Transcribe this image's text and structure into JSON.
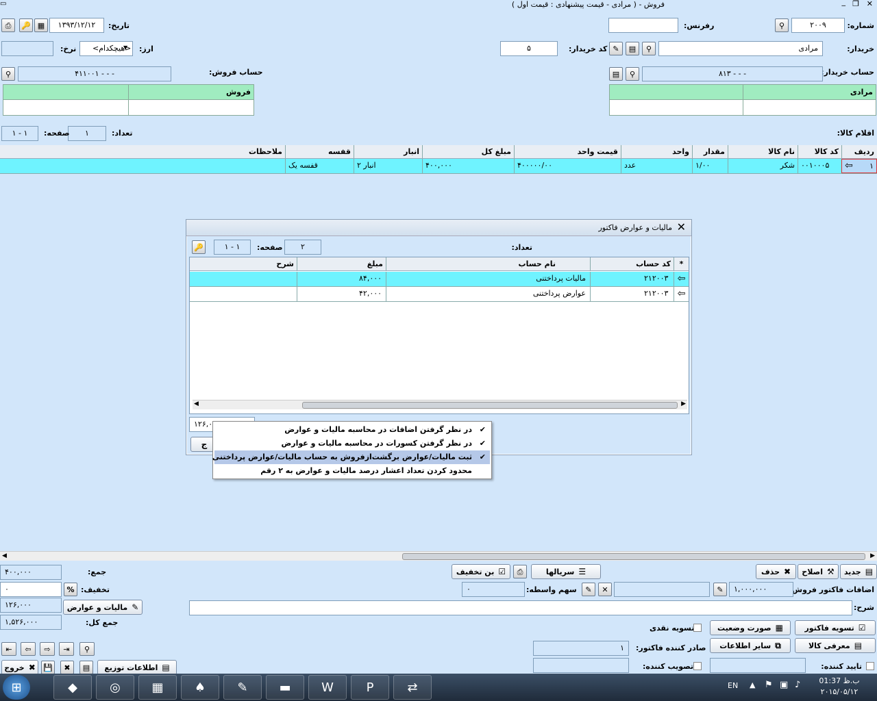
{
  "window": {
    "title": "فروش - ( مرادی - قیمت پیشنهادی : قیمت اول )"
  },
  "header": {
    "number_label": "شماره:",
    "number_value": "۲۰۰۹",
    "ref_label": "رفرنس:",
    "ref_value": "",
    "date_label": "تاریخ:",
    "date_value": "۱۳۹۳/۱۲/۱۲",
    "buyer_label": "خریدار:",
    "buyer_value": "مرادی",
    "buyer_code_label": "کد خریدار:",
    "buyer_code_value": "۵",
    "currency_label": "ارز:",
    "currency_value": "<هیچکدام>",
    "rate_label": "نرخ:",
    "rate_value": ""
  },
  "buyer_account": {
    "label": "حساب خریدار:",
    "value": "۸۱۳ - - -",
    "table_header": "مرادی"
  },
  "sales_account": {
    "label": "حساب فروش:",
    "value": "۴۱۱۰۰۱ - - -",
    "table_header": "فروش"
  },
  "items_bar": {
    "label": "اقلام کالا:",
    "count_label": "تعداد:",
    "count_value": "۱",
    "page_label": "صفحه:",
    "page_value": "۱ - ۱"
  },
  "items_table": {
    "headers": [
      "ردیف",
      "کد کالا",
      "نام کالا",
      "مقدار",
      "واحد",
      "قیمت واحد",
      "مبلغ کل",
      "انبار",
      "قفسه",
      "ملاحظات"
    ],
    "rows": [
      [
        "۱",
        "۰۰۱۰۰۰۵",
        "شکر",
        "۱/۰۰",
        "عدد",
        "۴۰۰۰۰۰/۰۰",
        "۴۰۰,۰۰۰",
        "انبار ۲",
        "قفسه یک",
        ""
      ]
    ]
  },
  "tax_dialog": {
    "title": "مالیات و عوارض فاکتور",
    "count_label": "تعداد:",
    "count_value": "۲",
    "page_label": "صفحه:",
    "page_value": "۱ - ۱",
    "headers": [
      "*",
      "کد حساب",
      "نام حساب",
      "مبلغ",
      "شرح"
    ],
    "rows": [
      [
        "۲۱۲۰۰۳",
        "مالیات پرداختنی",
        "۸۴,۰۰۰",
        ""
      ],
      [
        "۲۱۲۰۰۳",
        "عوارض پرداختنی",
        "۴۲,۰۰۰",
        ""
      ]
    ],
    "total_value": "۱۲۶,۰"
  },
  "context_menu": {
    "items": [
      {
        "label": "در نظر گرفتن اضافات در محاسبه مالیات و عوارض",
        "checked": "✔"
      },
      {
        "label": "در نظر گرفتن کسورات در محاسبه مالیات و عوارض",
        "checked": "✔"
      },
      {
        "label": "ثبت مالیات/عوارض برگشت‌ازفروش به حساب مالیات/عوارض پرداختنی",
        "checked": "✔"
      },
      {
        "label": "محدود کردن تعداد اعشار درصد مالیات و عوارض به ۲ رقم",
        "checked": ""
      }
    ]
  },
  "footer": {
    "new": "جدید",
    "edit": "اصلاح",
    "delete": "حذف",
    "serials": "سریالها",
    "discount_coupon": "بن تخفیف",
    "additions_label": "اضافات فاکتور فروش:",
    "additions_value": "۱,۰۰۰,۰۰۰",
    "broker_label": "سهم واسطه:",
    "broker_value": "۰",
    "desc_label": "شرح:",
    "settle": "تسویه فاکتور",
    "statement": "صورت وضعیت",
    "cash_settle": "تسویه نقدی",
    "goods_intro": "معرفی کالا",
    "other_info": "سایر اطلاعات",
    "issuer_label": "صادر کننده فاکتور:",
    "issuer_value": "۱",
    "approver_label": "تایید کننده:",
    "ratifier_label": "تصویب کننده:",
    "sum_label": "جمع:",
    "sum_value": "۴۰۰,۰۰۰",
    "discount_label": "تخفیف:",
    "discount_value": "۰",
    "percent": "%",
    "tax_button": "مالیات و عوارض",
    "tax_value": "۱۲۶,۰۰۰",
    "total_label": "جمع کل:",
    "total_value": "۱,۵۲۶,۰۰۰",
    "distribution": "اطلاعات توزیع",
    "exit": "خروج"
  },
  "taskbar": {
    "lang": "EN",
    "time": "01:37 ب.ظ",
    "date": "۲۰۱۵/۰۵/۱۲"
  }
}
